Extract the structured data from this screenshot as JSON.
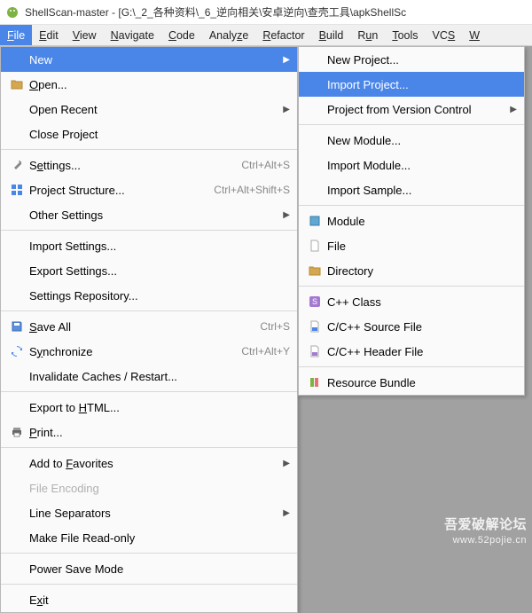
{
  "title": "ShellScan-master - [G:\\_2_各种资料\\_6_逆向相关\\安卓逆向\\查壳工具\\apkShellSc",
  "menubar": [
    "File",
    "Edit",
    "View",
    "Navigate",
    "Code",
    "Analyze",
    "Refactor",
    "Build",
    "Run",
    "Tools",
    "VCS",
    "W"
  ],
  "file_menu": {
    "new": "New",
    "open": "Open...",
    "open_recent": "Open Recent",
    "close_project": "Close Project",
    "settings": "Settings...",
    "settings_sc": "Ctrl+Alt+S",
    "project_structure": "Project Structure...",
    "project_structure_sc": "Ctrl+Alt+Shift+S",
    "other_settings": "Other Settings",
    "import_settings": "Import Settings...",
    "export_settings": "Export Settings...",
    "settings_repo": "Settings Repository...",
    "save_all": "Save All",
    "save_all_sc": "Ctrl+S",
    "synchronize": "Synchronize",
    "synchronize_sc": "Ctrl+Alt+Y",
    "invalidate": "Invalidate Caches / Restart...",
    "export_html": "Export to HTML...",
    "print": "Print...",
    "add_favorites": "Add to Favorites",
    "file_encoding": "File Encoding",
    "line_separators": "Line Separators",
    "make_readonly": "Make File Read-only",
    "power_save": "Power Save Mode",
    "exit": "Exit"
  },
  "new_menu": {
    "new_project": "New Project...",
    "import_project": "Import Project...",
    "project_vc": "Project from Version Control",
    "new_module": "New Module...",
    "import_module": "Import Module...",
    "import_sample": "Import Sample...",
    "module": "Module",
    "file": "File",
    "directory": "Directory",
    "cpp_class": "C++ Class",
    "cpp_source": "C/C++ Source File",
    "cpp_header": "C/C++ Header File",
    "resource_bundle": "Resource Bundle"
  },
  "watermark": {
    "line1": "吾爱破解论坛",
    "line2": "www.52pojie.cn"
  }
}
